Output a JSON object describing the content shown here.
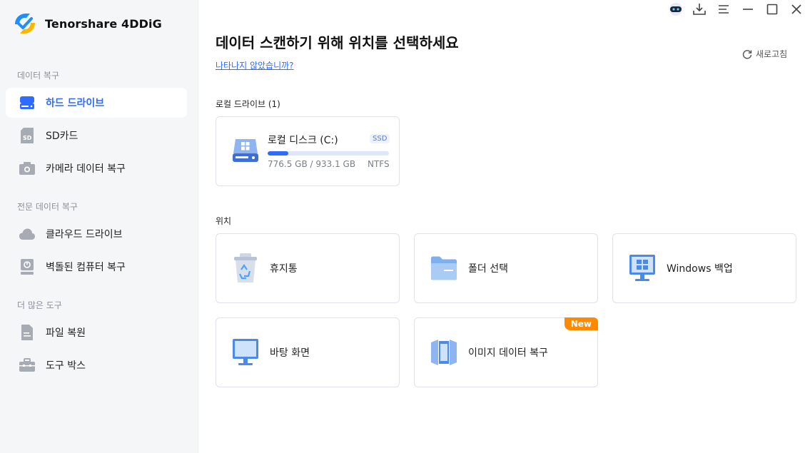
{
  "app": {
    "name": "Tenorshare 4DDiG"
  },
  "sidebar": {
    "sections": [
      {
        "title": "데이터 복구"
      },
      {
        "title": "전문 데이터 복구"
      },
      {
        "title": "더 많은 도구"
      }
    ],
    "items": [
      {
        "label": "하드 드라이브",
        "icon": "hard-drive-icon",
        "active": true
      },
      {
        "label": "SD카드",
        "icon": "sd-card-icon"
      },
      {
        "label": "카메라 데이터 복구",
        "icon": "camera-icon"
      },
      {
        "label": "클라우드 드라이브",
        "icon": "cloud-icon"
      },
      {
        "label": "벽돌된 컴퓨터 복구",
        "icon": "bricked-computer-icon"
      },
      {
        "label": "파일 복원",
        "icon": "file-icon"
      },
      {
        "label": "도구 박스",
        "icon": "toolbox-icon"
      }
    ]
  },
  "main": {
    "title": "데이터 스캔하기 위해 위치를 선택하세요",
    "help_link": "나타나지 않았습니까?",
    "refresh_label": "새로고침",
    "local_drives_label": "로컬 드라이브 (1)",
    "drive": {
      "name": "로컬 디스크 (C:)",
      "type": "SSD",
      "size_text": "776.5 GB / 933.1 GB",
      "filesystem": "NTFS",
      "usage_fraction": 0.17
    },
    "locations_label": "위치",
    "locations": [
      {
        "label": "휴지통",
        "icon": "recycle-bin-icon"
      },
      {
        "label": "폴더 선택",
        "icon": "folder-icon"
      },
      {
        "label": "Windows 백업",
        "icon": "windows-backup-icon"
      },
      {
        "label": "바탕 화면",
        "icon": "desktop-icon"
      },
      {
        "label": "이미지 데이터 복구",
        "icon": "image-recovery-icon",
        "badge": "New"
      }
    ]
  },
  "colors": {
    "accent": "#2f6bff",
    "badge": "#ff8a00",
    "sidebar_bg": "#f5f6f8"
  }
}
